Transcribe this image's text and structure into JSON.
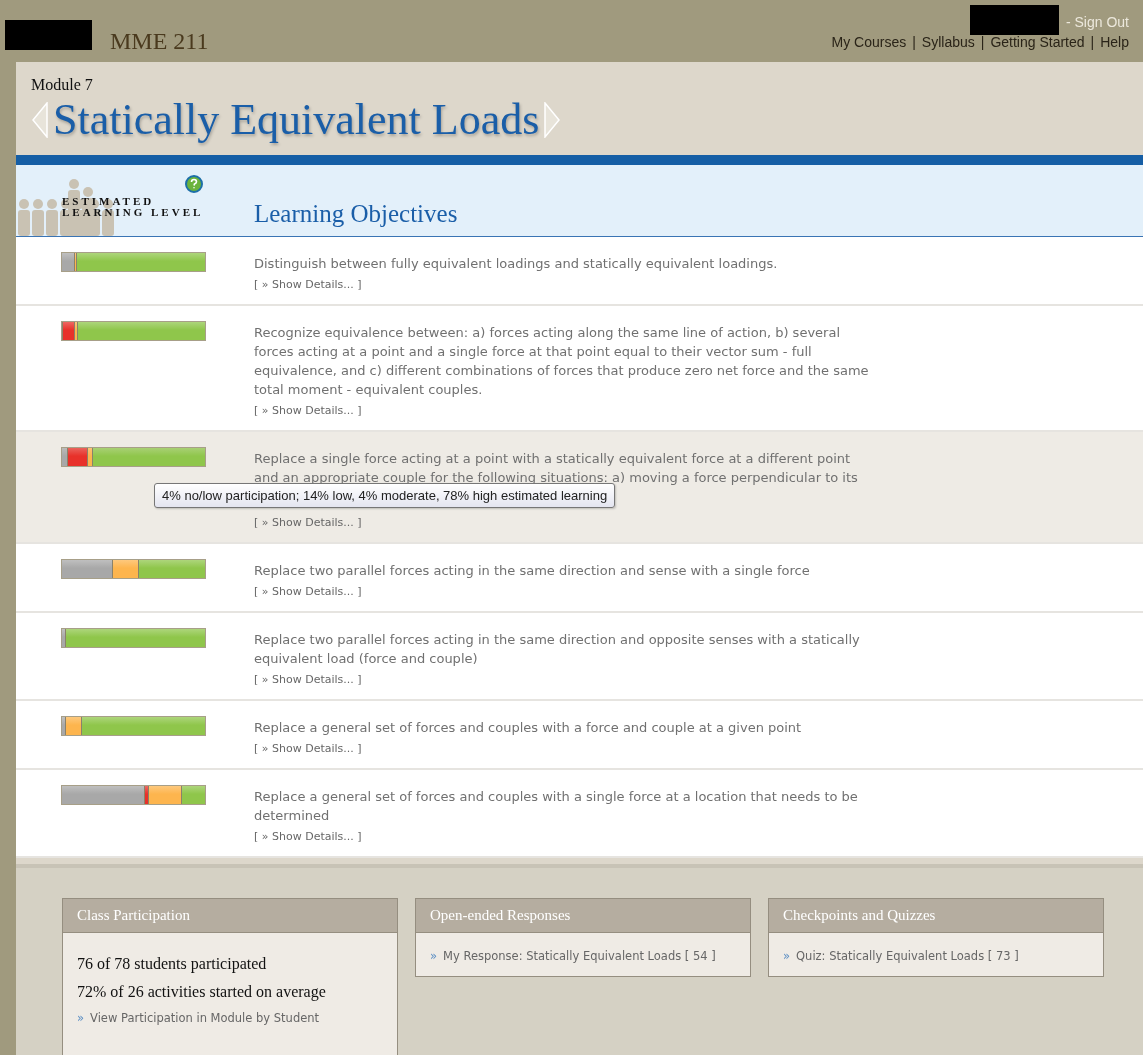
{
  "header": {
    "course": "MME 211",
    "sign_out": "- Sign Out",
    "nav_separator": "|",
    "nav": [
      "My Courses",
      "Syllabus",
      "Getting Started",
      "Help"
    ]
  },
  "module": {
    "label": "Module 7",
    "title": "Statically Equivalent Loads"
  },
  "objectives_header": {
    "level_heading_line1": "ESTIMATED",
    "level_heading_line2": "LEARNING LEVEL",
    "title": "Learning Objectives"
  },
  "objectives": [
    {
      "text": "Distinguish between fully equivalent loadings and statically equivalent loadings.",
      "details": "[ » Show Details... ]",
      "hovered": false,
      "segments": [
        {
          "kind": "none"
        },
        {
          "kind": "moderate"
        },
        {
          "kind": "high"
        }
      ]
    },
    {
      "text": "Recognize equivalence between: a) forces acting along the same line of action, b) several forces acting at a point and a single force at that point equal to their vector sum - full equivalence, and c) different combinations of forces that produce zero net force and the same total moment - equivalent couples.",
      "details": "[ » Show Details... ]",
      "hovered": false,
      "segments": [
        {
          "kind": "none"
        },
        {
          "kind": "low"
        },
        {
          "kind": "moderate"
        },
        {
          "kind": "high"
        }
      ]
    },
    {
      "text": "Replace a single force acting at a point with a statically equivalent force at a different point and an appropriate couple for the following situations: a) moving a force perpendicular to its",
      "details": "[ » Show Details... ]",
      "hovered": true,
      "segments": [
        {
          "kind": "none"
        },
        {
          "kind": "low"
        },
        {
          "kind": "moderate"
        },
        {
          "kind": "high"
        }
      ]
    },
    {
      "text": "Replace two parallel forces acting in the same direction and sense with a single force",
      "details": "[ » Show Details... ]",
      "hovered": false,
      "segments": [
        {
          "kind": "none"
        },
        {
          "kind": "moderate"
        },
        {
          "kind": "high"
        }
      ]
    },
    {
      "text": "Replace two parallel forces acting in the same direction and opposite senses with a statically equivalent load (force and couple)",
      "details": "[ » Show Details... ]",
      "hovered": false,
      "segments": [
        {
          "kind": "none"
        },
        {
          "kind": "high"
        }
      ]
    },
    {
      "text": "Replace a general set of forces and couples with a force and couple at a given point",
      "details": "[ » Show Details... ]",
      "hovered": false,
      "segments": [
        {
          "kind": "none"
        },
        {
          "kind": "moderate"
        },
        {
          "kind": "high"
        }
      ]
    },
    {
      "text": "Replace a general set of forces and couples with a single force at a location that needs to be determined",
      "details": "[ » Show Details... ]",
      "hovered": false,
      "segments": [
        {
          "kind": "none"
        },
        {
          "kind": "low"
        },
        {
          "kind": "moderate"
        },
        {
          "kind": "high"
        }
      ]
    }
  ],
  "tooltip": {
    "text": "4% no/low participation; 14% low, 4% moderate, 78% high estimated learning"
  },
  "panels": [
    {
      "title": "Class Participation",
      "stats": [
        "76 of 78 students participated",
        "72% of 26 activities started on average"
      ],
      "links": [
        {
          "marker": "»",
          "text": "View Participation in Module by Student"
        }
      ]
    },
    {
      "title": "Open-ended Responses",
      "links": [
        {
          "marker": "»",
          "text": "My Response: Statically Equivalent Loads [ 54 ]"
        }
      ]
    },
    {
      "title": "Checkpoints and Quizzes",
      "links": [
        {
          "marker": "»",
          "text": "Quiz: Statically Equivalent Loads [ 73 ]"
        }
      ]
    }
  ]
}
